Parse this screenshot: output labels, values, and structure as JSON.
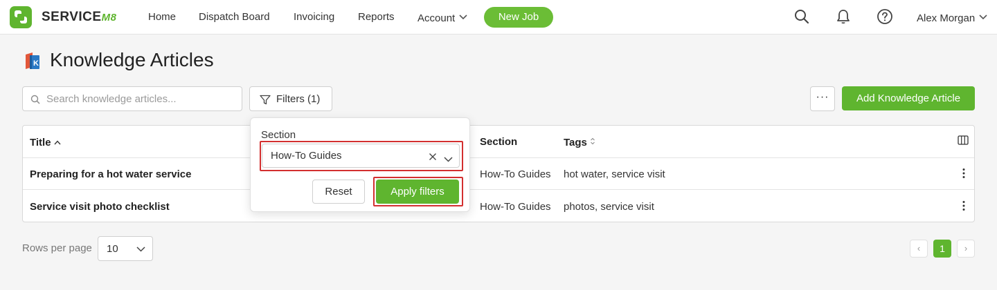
{
  "brand": {
    "name": "SERVICE",
    "suffix": "M8",
    "accent": "#5fb52f"
  },
  "nav": {
    "items": [
      {
        "label": "Home"
      },
      {
        "label": "Dispatch Board"
      },
      {
        "label": "Invoicing"
      },
      {
        "label": "Reports"
      },
      {
        "label": "Account"
      }
    ],
    "new_job_label": "New Job",
    "user_name": "Alex Morgan",
    "icons": [
      "search-icon",
      "bell-icon",
      "help-icon"
    ]
  },
  "page": {
    "title": "Knowledge Articles",
    "icon": "book-icon"
  },
  "toolbar": {
    "search_placeholder": "Search knowledge articles...",
    "search_value": "",
    "filters_label": "Filters (1)",
    "more_label": "···",
    "add_label": "Add Knowledge Article"
  },
  "table": {
    "columns": [
      {
        "label": "Title"
      },
      {
        "label": "Section"
      },
      {
        "label": "Tags"
      }
    ],
    "rows": [
      {
        "title": "Preparing for a hot water service",
        "section": "How-To Guides",
        "tags": "hot water, service visit"
      },
      {
        "title": "Service visit photo checklist",
        "section": "How-To Guides",
        "tags": "photos, service visit"
      }
    ]
  },
  "filter_popover": {
    "section_label": "Section",
    "section_value": "How-To Guides",
    "reset_label": "Reset",
    "apply_label": "Apply filters",
    "highlight_color": "#d32f2f"
  },
  "footer": {
    "rows_per_page_label": "Rows per page",
    "rows_per_page_value": "10",
    "prev_label": "‹",
    "current_page": "1",
    "next_label": "›"
  }
}
